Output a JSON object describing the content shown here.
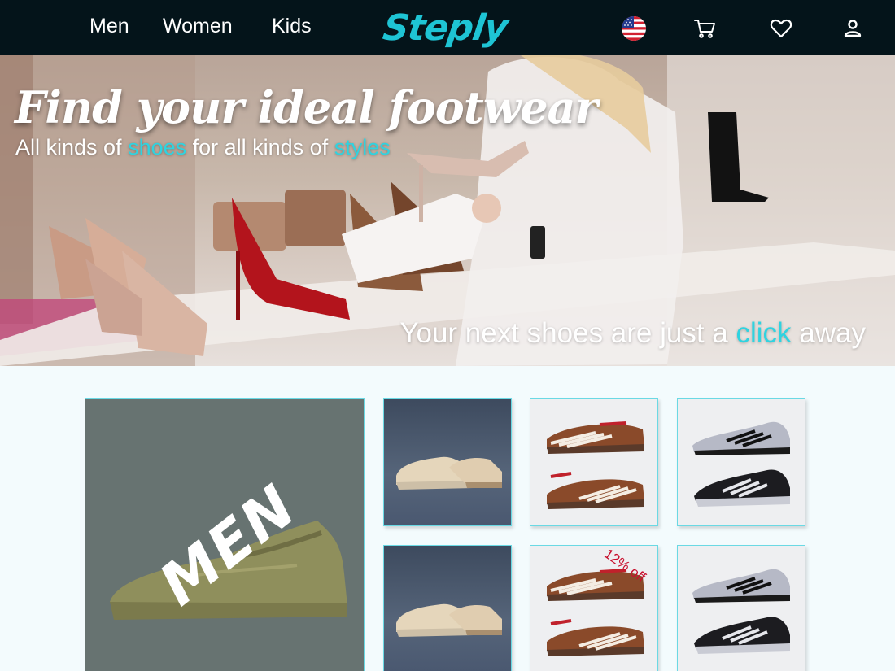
{
  "nav": {
    "links": [
      "Men",
      "Women",
      "Kids"
    ],
    "logo": "Steply",
    "icons": [
      "us-flag-icon",
      "cart-icon",
      "heart-icon",
      "user-icon"
    ]
  },
  "hero": {
    "title": "Find your ideal footwear",
    "subtitle_parts": [
      "All kinds of ",
      "shoes",
      " for all kinds of ",
      "styles"
    ],
    "tagline_parts": [
      "Your next shoes are just a ",
      "click",
      " away"
    ]
  },
  "category": {
    "label": "MEN"
  },
  "products": [
    {
      "name": "tan-sneaker"
    },
    {
      "name": "leopard-sneaker"
    },
    {
      "name": "running-shoe"
    },
    {
      "name": "tan-sneaker"
    },
    {
      "name": "leopard-sneaker",
      "badge": "12% off"
    },
    {
      "name": "running-shoe"
    }
  ],
  "colors": {
    "nav_bg": "#04141a",
    "accent": "#2fd3e0",
    "badge": "#c8102e"
  }
}
